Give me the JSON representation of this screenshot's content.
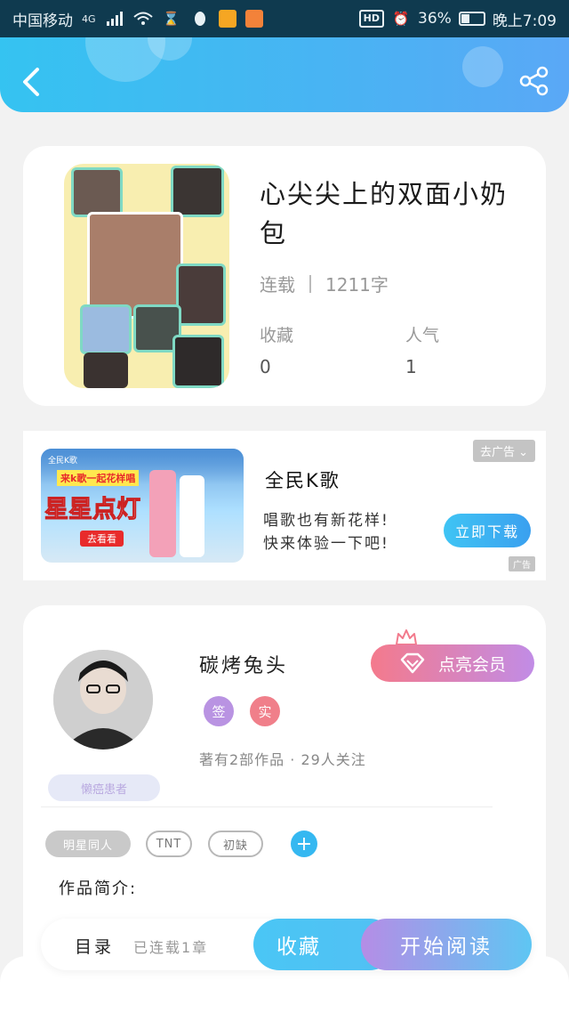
{
  "status_bar": {
    "carrier": "中国移动",
    "network": "4G",
    "battery": "36%",
    "time": "晚上7:09",
    "hd_label": "HD"
  },
  "header": {
    "back_icon": "back-arrow-icon",
    "share_icon": "share-icon"
  },
  "book": {
    "title": "心尖尖上的双面小奶包",
    "status": "连载",
    "word_count": "1211字",
    "collect_label": "收藏",
    "collect_value": "0",
    "popularity_label": "人气",
    "popularity_value": "1"
  },
  "ad": {
    "image_logo": "全民K歌",
    "image_subtitle": "来k歌一起花样唱",
    "image_headline": "星星点灯",
    "image_button": "去看看",
    "close_tag": "去广告",
    "title": "全民K歌",
    "desc_line1": "唱歌也有新花样!",
    "desc_line2": "快来体验一下吧!",
    "download_label": "立即下载",
    "ad_mark": "广告"
  },
  "author": {
    "name": "碳烤兔头",
    "vip_label": "点亮会员",
    "badge_sign": "签",
    "badge_real": "实",
    "meta": "著有2部作品 · 29人关注",
    "decor_tag": "懒癌患者",
    "tags": [
      "明星同人",
      "TNT",
      "初缺"
    ],
    "intro_label": "作品简介:"
  },
  "bottom_bar": {
    "toc_label": "目录",
    "chapter_count": "已连载1章",
    "favorite_label": "收藏",
    "read_label": "开始阅读"
  },
  "colors": {
    "accent": "#35c3f1",
    "vip_gradient_start": "#f47a8c",
    "vip_gradient_end": "#c18ce6"
  }
}
